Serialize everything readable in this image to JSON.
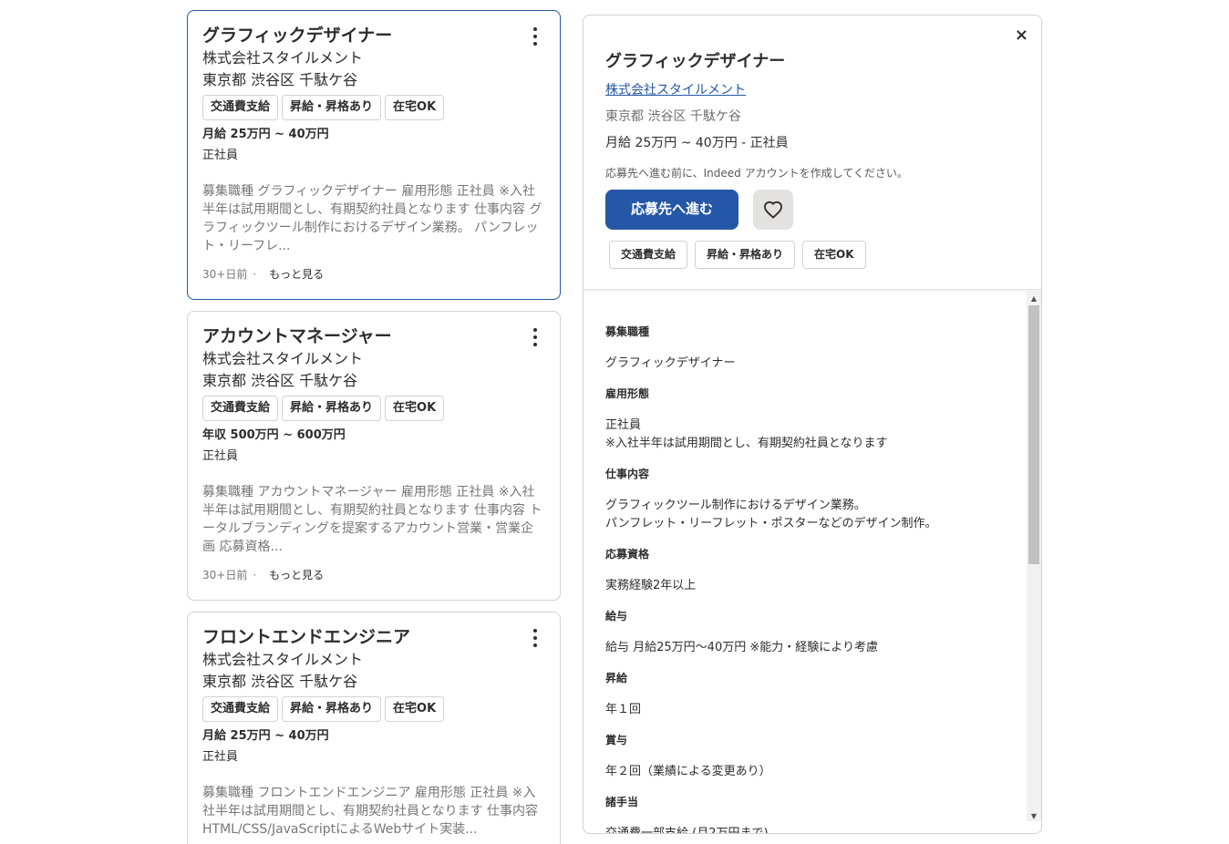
{
  "jobs": [
    {
      "title": "グラフィックデザイナー",
      "company": "株式会社スタイルメント",
      "location": "東京都 渋谷区 千駄ケ谷",
      "tags": [
        "交通費支給",
        "昇給・昇格あり",
        "在宅OK"
      ],
      "salary": "月給 25万円 ~ 40万円",
      "type": "正社員",
      "snippet": "募集職種 グラフィックデザイナー 雇用形態 正社員 ※入社半年は試用期間とし、有期契約社員となります 仕事内容 グラフィックツール制作におけるデザイン業務。 パンフレット・リーフレ...",
      "posted": "30+日前",
      "separator": "·",
      "more": "もっと見る"
    },
    {
      "title": "アカウントマネージャー",
      "company": "株式会社スタイルメント",
      "location": "東京都 渋谷区 千駄ケ谷",
      "tags": [
        "交通費支給",
        "昇給・昇格あり",
        "在宅OK"
      ],
      "salary": "年収 500万円 ~ 600万円",
      "type": "正社員",
      "snippet": "募集職種 アカウントマネージャー 雇用形態 正社員 ※入社半年は試用期間とし、有期契約社員となります 仕事内容 トータルブランディングを提案するアカウント営業・営業企画 応募資格...",
      "posted": "30+日前",
      "separator": "·",
      "more": "もっと見る"
    },
    {
      "title": "フロントエンドエンジニア",
      "company": "株式会社スタイルメント",
      "location": "東京都 渋谷区 千駄ケ谷",
      "tags": [
        "交通費支給",
        "昇給・昇格あり",
        "在宅OK"
      ],
      "salary": "月給 25万円 ~ 40万円",
      "type": "正社員",
      "snippet": "募集職種 フロントエンドエンジニア 雇用形態 正社員 ※入社半年は試用期間とし、有期契約社員となります 仕事内容 HTML/CSS/JavaScriptによるWebサイト実装...",
      "posted": "",
      "separator": "",
      "more": ""
    }
  ],
  "detail": {
    "close": "×",
    "title": "グラフィックデザイナー",
    "company": "株式会社スタイルメント",
    "location": "東京都 渋谷区 千駄ケ谷",
    "salary": "月給 25万円 ~ 40万円  - 正社員",
    "notice": "応募先へ進む前に、Indeed アカウントを作成してください。",
    "apply": "応募先へ進む",
    "tags": [
      "交通費支給",
      "昇給・昇格あり",
      "在宅OK"
    ],
    "sections": [
      {
        "heading": "募集職種",
        "body": [
          "グラフィックデザイナー"
        ]
      },
      {
        "heading": "雇用形態",
        "body": [
          "正社員",
          "※入社半年は試用期間とし、有期契約社員となります"
        ]
      },
      {
        "heading": "仕事内容",
        "body": [
          "グラフィックツール制作におけるデザイン業務。",
          "パンフレット・リーフレット・ポスターなどのデザイン制作。"
        ]
      },
      {
        "heading": "応募資格",
        "body": [
          "実務経験2年以上"
        ]
      },
      {
        "heading": "給与",
        "body": [
          "給与 月給25万円〜40万円 ※能力・経験により考慮"
        ]
      },
      {
        "heading": "昇給",
        "body": [
          "年１回"
        ]
      },
      {
        "heading": "賞与",
        "body": [
          "年２回（業績による変更あり）"
        ]
      },
      {
        "heading": "諸手当",
        "body": [
          "交通費一部支給 (月2万円まで)"
        ]
      }
    ]
  },
  "icons": {
    "kebab": "more-vertical-icon",
    "heart": "heart-icon",
    "close": "close-icon"
  },
  "colors": {
    "accent": "#2557a7",
    "border": "#d4d2d0",
    "muted": "#767676"
  }
}
